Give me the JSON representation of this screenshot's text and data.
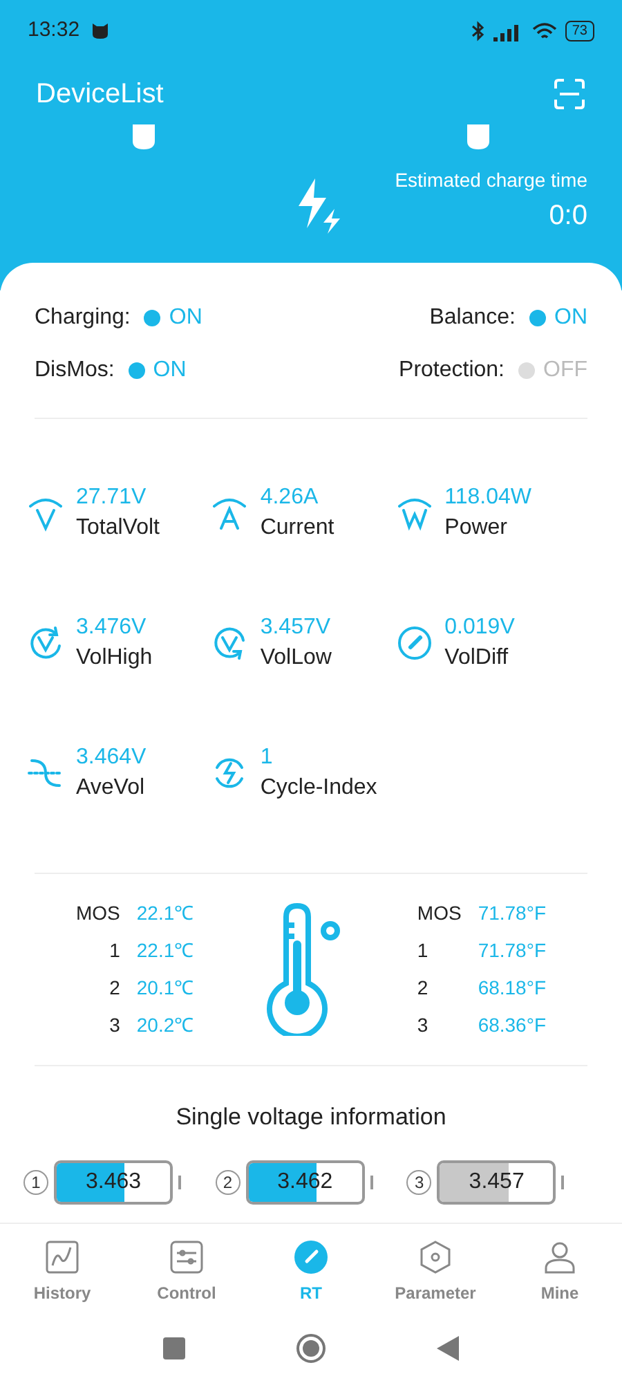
{
  "status_bar": {
    "time": "13:32",
    "battery": "73"
  },
  "header": {
    "title": "DeviceList"
  },
  "charge": {
    "label": "Estimated charge time",
    "value": "0:0"
  },
  "switches": [
    {
      "label": "Charging:",
      "value": "ON",
      "on": true
    },
    {
      "label": "Balance:",
      "value": "ON",
      "on": true
    },
    {
      "label": "DisMos:",
      "value": "ON",
      "on": true
    },
    {
      "label": "Protection:",
      "value": "OFF",
      "on": false
    }
  ],
  "metrics": [
    {
      "kind": "volt",
      "value": "27.71V",
      "label": "TotalVolt"
    },
    {
      "kind": "amp",
      "value": "4.26A",
      "label": "Current"
    },
    {
      "kind": "watt",
      "value": "118.04W",
      "label": "Power"
    },
    {
      "kind": "high",
      "value": "3.476V",
      "label": "VolHigh"
    },
    {
      "kind": "low",
      "value": "3.457V",
      "label": "VolLow"
    },
    {
      "kind": "diff",
      "value": "0.019V",
      "label": "VolDiff"
    },
    {
      "kind": "ave",
      "value": "3.464V",
      "label": "AveVol"
    },
    {
      "kind": "cycle",
      "value": "1",
      "label": "Cycle-Index"
    }
  ],
  "temps_c": [
    {
      "name": "MOS",
      "value": "22.1℃"
    },
    {
      "name": "1",
      "value": "22.1℃"
    },
    {
      "name": "2",
      "value": "20.1℃"
    },
    {
      "name": "3",
      "value": "20.2℃"
    }
  ],
  "temps_f": [
    {
      "name": "MOS",
      "value": "71.78°F"
    },
    {
      "name": "1",
      "value": "71.78°F"
    },
    {
      "name": "2",
      "value": "68.18°F"
    },
    {
      "name": "3",
      "value": "68.36°F"
    }
  ],
  "cells_title": "Single voltage information",
  "cells": [
    {
      "index": "1",
      "value": "3.463",
      "level": 0.6,
      "lowest": false
    },
    {
      "index": "2",
      "value": "3.462",
      "level": 0.6,
      "lowest": false
    },
    {
      "index": "3",
      "value": "3.457",
      "level": 0.6,
      "lowest": true
    }
  ],
  "nav": [
    {
      "kind": "history",
      "label": "History",
      "selected": false
    },
    {
      "kind": "control",
      "label": "Control",
      "selected": false
    },
    {
      "kind": "rt",
      "label": "RT",
      "selected": true
    },
    {
      "kind": "parameter",
      "label": "Parameter",
      "selected": false
    },
    {
      "kind": "mine",
      "label": "Mine",
      "selected": false
    }
  ]
}
